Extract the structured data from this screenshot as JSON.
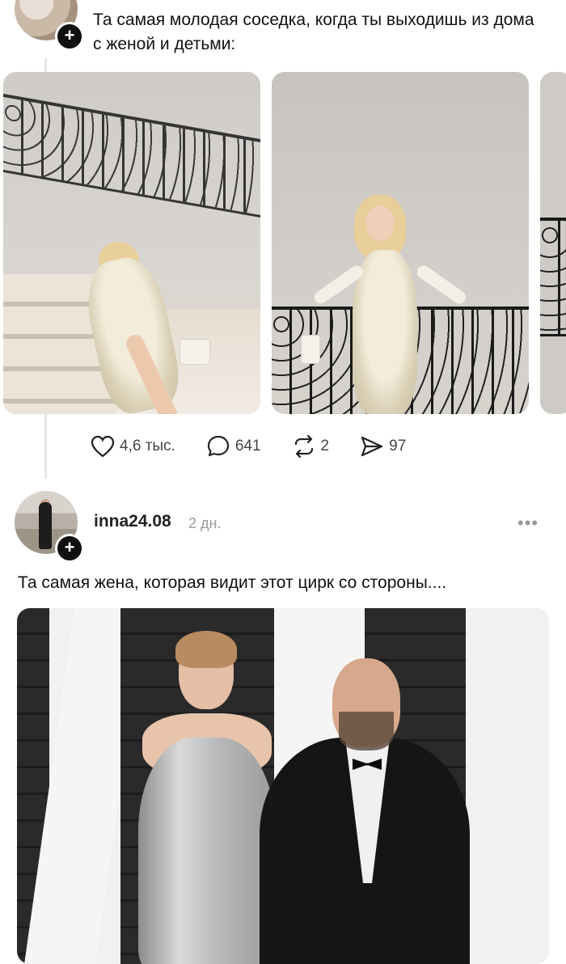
{
  "post1": {
    "text": "Та самая молодая соседка, когда ты выходишь из дома с женой и детьми:",
    "actions": {
      "likes": "4,6 тыс.",
      "comments": "641",
      "reposts": "2",
      "shares": "97"
    }
  },
  "post2": {
    "username": "inna24.08",
    "time": "2 дн.",
    "more": "•••",
    "text": "Та самая жена, которая видит этот цирк со стороны...."
  },
  "icons": {
    "follow": "+"
  }
}
